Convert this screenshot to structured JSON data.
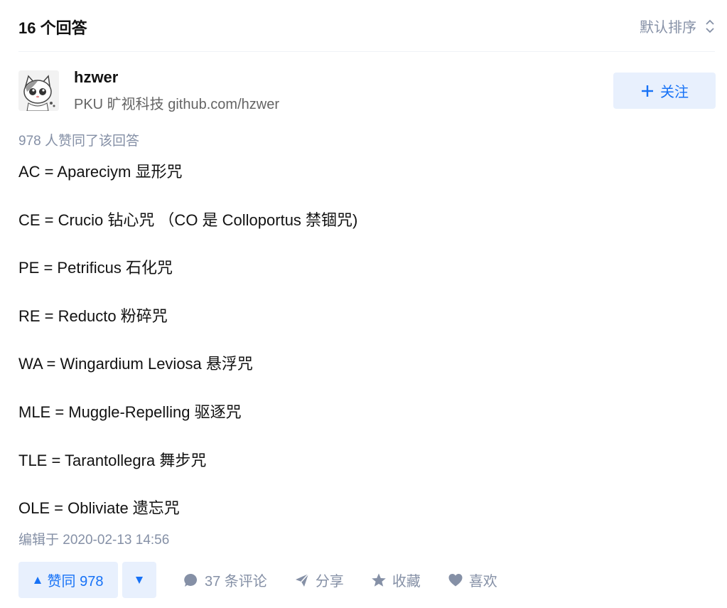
{
  "header": {
    "answers_count": "16 个回答",
    "sort_label": "默认排序"
  },
  "author": {
    "name": "hzwer",
    "bio": "PKU 旷视科技 github.com/hzwer",
    "follow_label": "关注"
  },
  "vote_summary": "978 人赞同了该回答",
  "content": [
    "AC = Apareciym 显形咒",
    "CE = Crucio 钻心咒 （CO 是 Colloportus 禁锢咒)",
    "PE = Petrificus 石化咒",
    "RE = Reducto 粉碎咒",
    "WA = Wingardium Leviosa 悬浮咒",
    "MLE = Muggle-Repelling 驱逐咒",
    "TLE = Tarantollegra 舞步咒",
    "OLE = Obliviate 遗忘咒"
  ],
  "edit_time": "编辑于 2020-02-13 14:56",
  "actions": {
    "upvote_label": "赞同 978",
    "comments_label": "37 条评论",
    "share_label": "分享",
    "collect_label": "收藏",
    "like_label": "喜欢"
  },
  "colors": {
    "accent": "#1772f6",
    "accent_bg": "#e8f0fd",
    "muted": "#8590a6"
  }
}
